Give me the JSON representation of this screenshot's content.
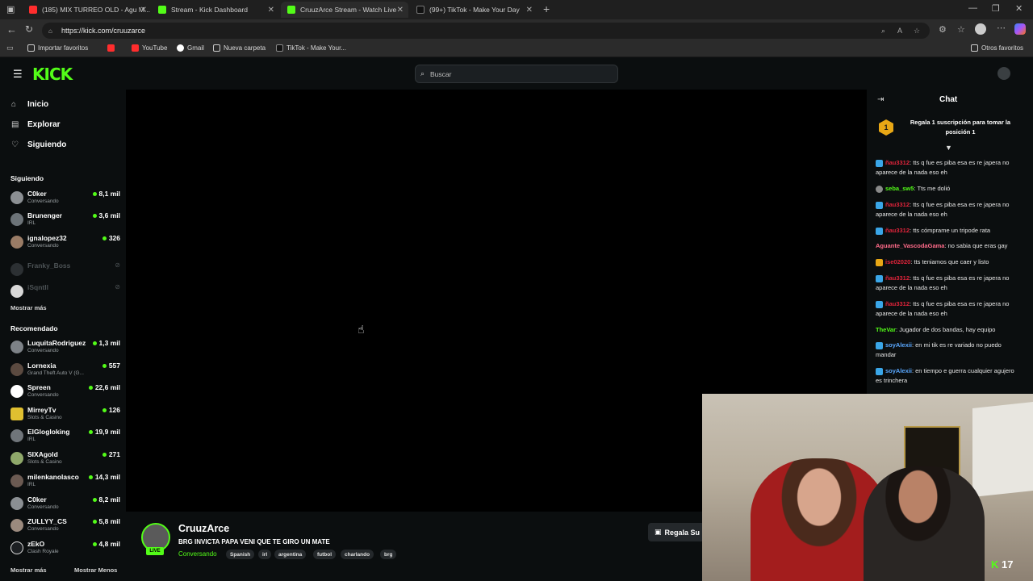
{
  "browser": {
    "tabs": [
      {
        "title": "(185) MIX TURREO OLD - Agu M...",
        "color": "#ff2d2d"
      },
      {
        "title": "Stream - Kick Dashboard",
        "color": "#53fc18"
      },
      {
        "title": "CruuzArce Stream - Watch Live o...",
        "color": "#53fc18"
      },
      {
        "title": "(99+) TikTok - Make Your Day",
        "color": "#ffffff"
      }
    ],
    "url": "https://kick.com/cruuzarce",
    "bookmarks": [
      {
        "label": "Importar favoritos"
      },
      {
        "label": ""
      },
      {
        "label": "YouTube"
      },
      {
        "label": "Gmail"
      },
      {
        "label": "Nueva carpeta"
      },
      {
        "label": "TikTok - Make Your..."
      }
    ],
    "other_bookmarks": "Otros favoritos"
  },
  "header": {
    "logo": "KICK",
    "search_placeholder": "Buscar"
  },
  "sidebar": {
    "nav": [
      {
        "label": "Inicio",
        "icon": "home-icon"
      },
      {
        "label": "Explorar",
        "icon": "browse-icon"
      },
      {
        "label": "Siguiendo",
        "icon": "heart-icon"
      }
    ],
    "following_title": "Siguiendo",
    "following": [
      {
        "name": "C0ker",
        "category": "Conversando",
        "viewers": "8,1 mil"
      },
      {
        "name": "Brunenger",
        "category": "IRL",
        "viewers": "3,6 mil"
      },
      {
        "name": "ignalopez32",
        "category": "Conversando",
        "viewers": "326"
      },
      {
        "name": "Franky_Boss",
        "category": "",
        "viewers": ""
      },
      {
        "name": "iSqntll",
        "category": "",
        "viewers": ""
      }
    ],
    "show_more_following": "Mostrar más",
    "recommended_title": "Recomendado",
    "recommended": [
      {
        "name": "LuquitaRodriguez",
        "category": "Conversando",
        "viewers": "1,3 mil"
      },
      {
        "name": "Lornexia",
        "category": "Grand Theft Auto V (G...",
        "viewers": "557"
      },
      {
        "name": "Spreen",
        "category": "Conversando",
        "viewers": "22,6 mil"
      },
      {
        "name": "MirreyTv",
        "category": "Slots & Casino",
        "viewers": "126"
      },
      {
        "name": "ElGlogloking",
        "category": "IRL",
        "viewers": "19,9 mil"
      },
      {
        "name": "SIXAgold",
        "category": "Slots & Casino",
        "viewers": "271"
      },
      {
        "name": "milenkanolasco",
        "category": "IRL",
        "viewers": "14,3 mil"
      },
      {
        "name": "C0ker",
        "category": "Conversando",
        "viewers": "8,2 mil"
      },
      {
        "name": "ZULLYY_CS",
        "category": "Conversando",
        "viewers": "5,8 mil"
      },
      {
        "name": "zEkO",
        "category": "Clash Royale",
        "viewers": "4,8 mil"
      }
    ],
    "show_more": "Mostrar más",
    "show_less": "Mostrar Menos"
  },
  "stream": {
    "streamer": "CruuzArce",
    "live_badge": "LIVE",
    "title": "BRG INVICTA PAPA VENI QUE TE GIRO UN MATE",
    "category": "Conversando",
    "tags": [
      "Spanish",
      "irl",
      "argentina",
      "futbol",
      "charlando",
      "brg"
    ],
    "gift_button": "Regala Su"
  },
  "chat": {
    "title": "Chat",
    "pinned_rank": "1",
    "pinned_text": "Regala 1 suscripción para tomar la posición 1",
    "messages": [
      {
        "user": "ñau3312",
        "color": "#e0243b",
        "badge": "#3aa6e8",
        "text": "tts q fue es piba esa es re japera no aparece de la nada eso eh"
      },
      {
        "user": "seba_sw5",
        "color": "#53fc18",
        "badge": "#8a8a8a",
        "text": "Tts me dolió"
      },
      {
        "user": "ñau3312",
        "color": "#e0243b",
        "badge": "#3aa6e8",
        "text": "tts q fue es piba esa es re japera no aparece de la nada eso eh"
      },
      {
        "user": "ñau3312",
        "color": "#e0243b",
        "badge": "#3aa6e8",
        "text": "tts cómprame un tripode rata"
      },
      {
        "user": "Aguante_VascodaGama",
        "color": "#ff6b8a",
        "badge": "",
        "text": "no sabia que eras gay"
      },
      {
        "user": "ise02020",
        "color": "#e0243b",
        "badge": "#e8a715",
        "text": "tts teniamos que caer y listo"
      },
      {
        "user": "ñau3312",
        "color": "#e0243b",
        "badge": "#3aa6e8",
        "text": "tts q fue es piba esa es re japera no aparece de la nada eso eh"
      },
      {
        "user": "ñau3312",
        "color": "#e0243b",
        "badge": "#3aa6e8",
        "text": "tts q fue es piba esa es re japera no aparece de la nada eso eh"
      },
      {
        "user": "TheVar",
        "color": "#53fc18",
        "badge": "",
        "text": "Jugador de dos bandas, hay equipo"
      },
      {
        "user": "soyAlexii",
        "color": "#5aa8ff",
        "badge": "#3aa6e8",
        "text": "en mi tik es re variado no puedo mandar"
      },
      {
        "user": "soyAlexii",
        "color": "#5aa8ff",
        "badge": "#3aa6e8",
        "text": "en tiempo e guerra cualquier agujero es trinchera"
      }
    ]
  },
  "webcam": {
    "overlay_count": "17"
  },
  "colors": {
    "accent": "#53fc18",
    "background": "#0b0e0f"
  }
}
